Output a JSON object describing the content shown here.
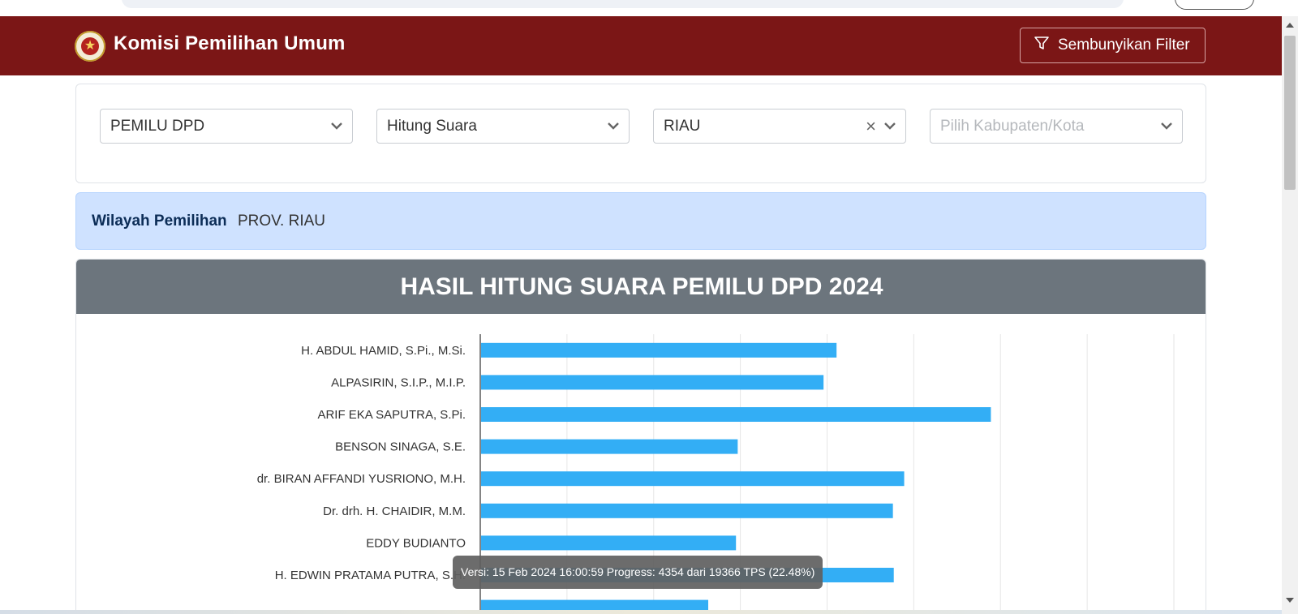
{
  "header": {
    "app_title": "Komisi Pemilihan Umum",
    "filter_button_label": "Sembunyikan Filter",
    "brand_color": "#7b1616"
  },
  "filters": {
    "election": "PEMILU DPD",
    "mode": "Hitung Suara",
    "province": "RIAU",
    "regency_placeholder": "Pilih Kabupaten/Kota"
  },
  "region": {
    "label": "Wilayah Pemilihan",
    "value": "PROV. RIAU"
  },
  "chart_title": "HASIL HITUNG SUARA PEMILU DPD 2024",
  "tooltip": "Versi: 15 Feb 2024 16:00:59 Progress: 4354 dari 19366 TPS (22.48%)",
  "progress": {
    "tps_counted": 4354,
    "tps_total": 19366,
    "percent": 22.48
  },
  "chart_data": {
    "type": "bar",
    "orientation": "horizontal",
    "bar_color": "#33aef5",
    "grid": true,
    "categories": [
      "H. ABDUL HAMID, S.Pi., M.Si.",
      "ALPASIRIN, S.I.P., M.I.P.",
      "ARIF EKA SAPUTRA, S.Pi.",
      "BENSON SINAGA, S.E.",
      "dr. BIRAN AFFANDI YUSRIONO, M.H.",
      "Dr. drh. H. CHAIDIR, M.M.",
      "EDDY BUDIANTO",
      "H. EDWIN PRATAMA PUTRA, S.H.",
      ""
    ],
    "values": [
      41,
      39.5,
      58.8,
      29.6,
      48.8,
      47.5,
      29.4,
      47.6,
      26.2
    ],
    "xlim": [
      0,
      80
    ]
  }
}
